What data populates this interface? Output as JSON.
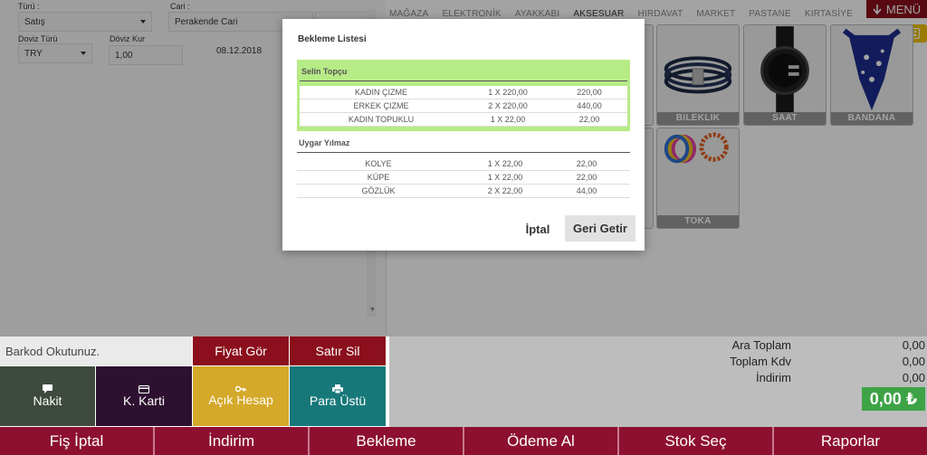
{
  "form": {
    "turu_label": "Türü :",
    "turu_value": "Satış",
    "cari_label": "Cari :",
    "cari_value": "Perakende Cari",
    "doviz_turu_label": "Doviz Türü",
    "doviz_turu_value": "TRY",
    "doviz_kur_label": "Döviz Kur",
    "doviz_kur_value": "1,00",
    "date": "08.12.2018"
  },
  "categories": [
    "MAĞAZA",
    "ELEKTRONİK",
    "AYAKKABI",
    "AKSESUAR",
    "HIRDAVAT",
    "MARKET",
    "PASTANE",
    "KIRTASİYE"
  ],
  "active_category": "AKSESUAR",
  "menu_label": "MENÜ",
  "products": [
    {
      "label": "BILEKLIK"
    },
    {
      "label": "SAAT"
    },
    {
      "label": "BANDANA"
    },
    {
      "label": "TOKA"
    }
  ],
  "modal": {
    "title": "Bekleme Listesi",
    "groups": [
      {
        "name": "Selin Topçu",
        "selected": true,
        "rows": [
          {
            "name": "KADIN ÇIZME",
            "qty": "1 X 220,00",
            "total": "220,00"
          },
          {
            "name": "ERKEK ÇIZME",
            "qty": "2 X 220,00",
            "total": "440,00"
          },
          {
            "name": "KADIN TOPUKLU",
            "qty": "1 X 22,00",
            "total": "22,00"
          }
        ]
      },
      {
        "name": "Uygar Yılmaz",
        "selected": false,
        "rows": [
          {
            "name": "KOLYE",
            "qty": "1 X 22,00",
            "total": "22,00"
          },
          {
            "name": "KÜPE",
            "qty": "1 X 22,00",
            "total": "22,00"
          },
          {
            "name": "GÖZLÜK",
            "qty": "2 X 22,00",
            "total": "44,00"
          }
        ]
      }
    ],
    "cancel_label": "İptal",
    "restore_label": "Geri Getir"
  },
  "barcode_placeholder": "Barkod Okutunuz.",
  "actions": {
    "fiyat_gor": "Fiyat Gör",
    "satir_sil": "Satır Sil",
    "nakit": "Nakit",
    "k_karti": "K. Karti",
    "acik_hesap": "Açık Hesap",
    "para_ustu": "Para Üstü"
  },
  "totals": {
    "ara_toplam_label": "Ara Toplam",
    "ara_toplam": "0,00",
    "toplam_kdv_label": "Toplam Kdv",
    "toplam_kdv": "0,00",
    "indirim_label": "İndirim",
    "indirim": "0,00",
    "grand_total": "0,00 ₺"
  },
  "bottom_bar": [
    "Fiş İptal",
    "İndirim",
    "Bekleme",
    "Ödeme Al",
    "Stok Seç",
    "Raporlar"
  ],
  "colors": {
    "nakit": "#3d4a3d",
    "k_karti": "#2e1030",
    "acik_hesap": "#d4a92a",
    "para_ustu": "#17787a",
    "fiyat_gor": "#8b0f1c",
    "satir_sil": "#8b0f1c",
    "bottom_bar": "#8d1030",
    "selected_group": "#b6eb86",
    "grand_total": "#3da346"
  }
}
